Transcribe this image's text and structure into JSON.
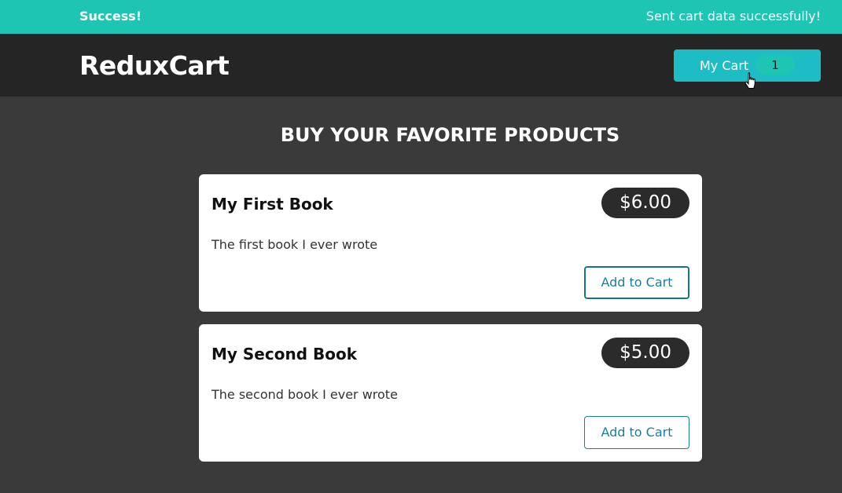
{
  "notification": {
    "title": "Success!",
    "message": "Sent cart data successfully!",
    "color": "#1ec5b3"
  },
  "header": {
    "logo": "ReduxCart",
    "cart_button": {
      "label": "My Cart",
      "count": "1"
    }
  },
  "main": {
    "heading": "BUY YOUR FAVORITE PRODUCTS",
    "products": [
      {
        "name": "My First Book",
        "price": "$6.00",
        "description": "The first book I ever wrote",
        "button_label": "Add to Cart"
      },
      {
        "name": "My Second Book",
        "price": "$5.00",
        "description": "The second book I ever wrote",
        "button_label": "Add to Cart"
      }
    ]
  },
  "colors": {
    "accent": "#1ebdc6",
    "header_bg": "#252525",
    "page_bg": "#3a3a3a",
    "price_bg": "#2b2b2b",
    "button_text": "#1a7ea0"
  },
  "icons": {
    "cursor": "hand-pointer-icon"
  }
}
